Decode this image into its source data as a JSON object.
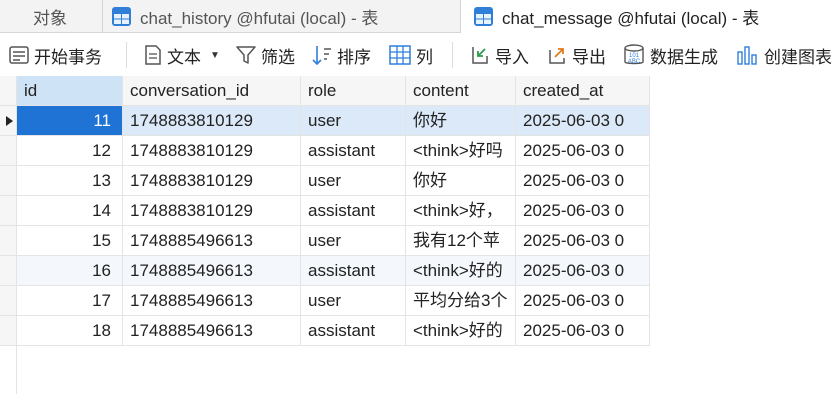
{
  "tabs": [
    {
      "label": "对象",
      "active": false
    },
    {
      "label": "chat_history @hfutai (local) - 表",
      "active": false
    },
    {
      "label": "chat_message @hfutai (local) - 表",
      "active": true
    }
  ],
  "toolbar": {
    "begin_transaction": "开始事务",
    "text": "文本",
    "filter": "筛选",
    "sort": "排序",
    "columns": "列",
    "import": "导入",
    "export": "导出",
    "generate_data": "数据生成",
    "create_chart": "创建图表"
  },
  "table": {
    "columns": [
      "id",
      "conversation_id",
      "role",
      "content",
      "created_at"
    ],
    "selected_row_index": 0,
    "rows": [
      {
        "id": "11",
        "conversation_id": "1748883810129",
        "role": "user",
        "content": "你好",
        "created_at": "2025-06-03 0"
      },
      {
        "id": "12",
        "conversation_id": "1748883810129",
        "role": "assistant",
        "content": "<think>好吗",
        "created_at": "2025-06-03 0"
      },
      {
        "id": "13",
        "conversation_id": "1748883810129",
        "role": "user",
        "content": "你好",
        "created_at": "2025-06-03 0"
      },
      {
        "id": "14",
        "conversation_id": "1748883810129",
        "role": "assistant",
        "content": "<think>好，",
        "created_at": "2025-06-03 0"
      },
      {
        "id": "15",
        "conversation_id": "1748885496613",
        "role": "user",
        "content": "我有12个苹",
        "created_at": "2025-06-03 0"
      },
      {
        "id": "16",
        "conversation_id": "1748885496613",
        "role": "assistant",
        "content": "<think>好的",
        "created_at": "2025-06-03 0"
      },
      {
        "id": "17",
        "conversation_id": "1748885496613",
        "role": "user",
        "content": "平均分给3个",
        "created_at": "2025-06-03 0"
      },
      {
        "id": "18",
        "conversation_id": "1748885496613",
        "role": "assistant",
        "content": "<think>好的",
        "created_at": "2025-06-03 0"
      }
    ]
  },
  "colors": {
    "accent": "#1e73d4",
    "selected_row": "#dbe9f8",
    "table_icon": "#2f7fd8"
  }
}
